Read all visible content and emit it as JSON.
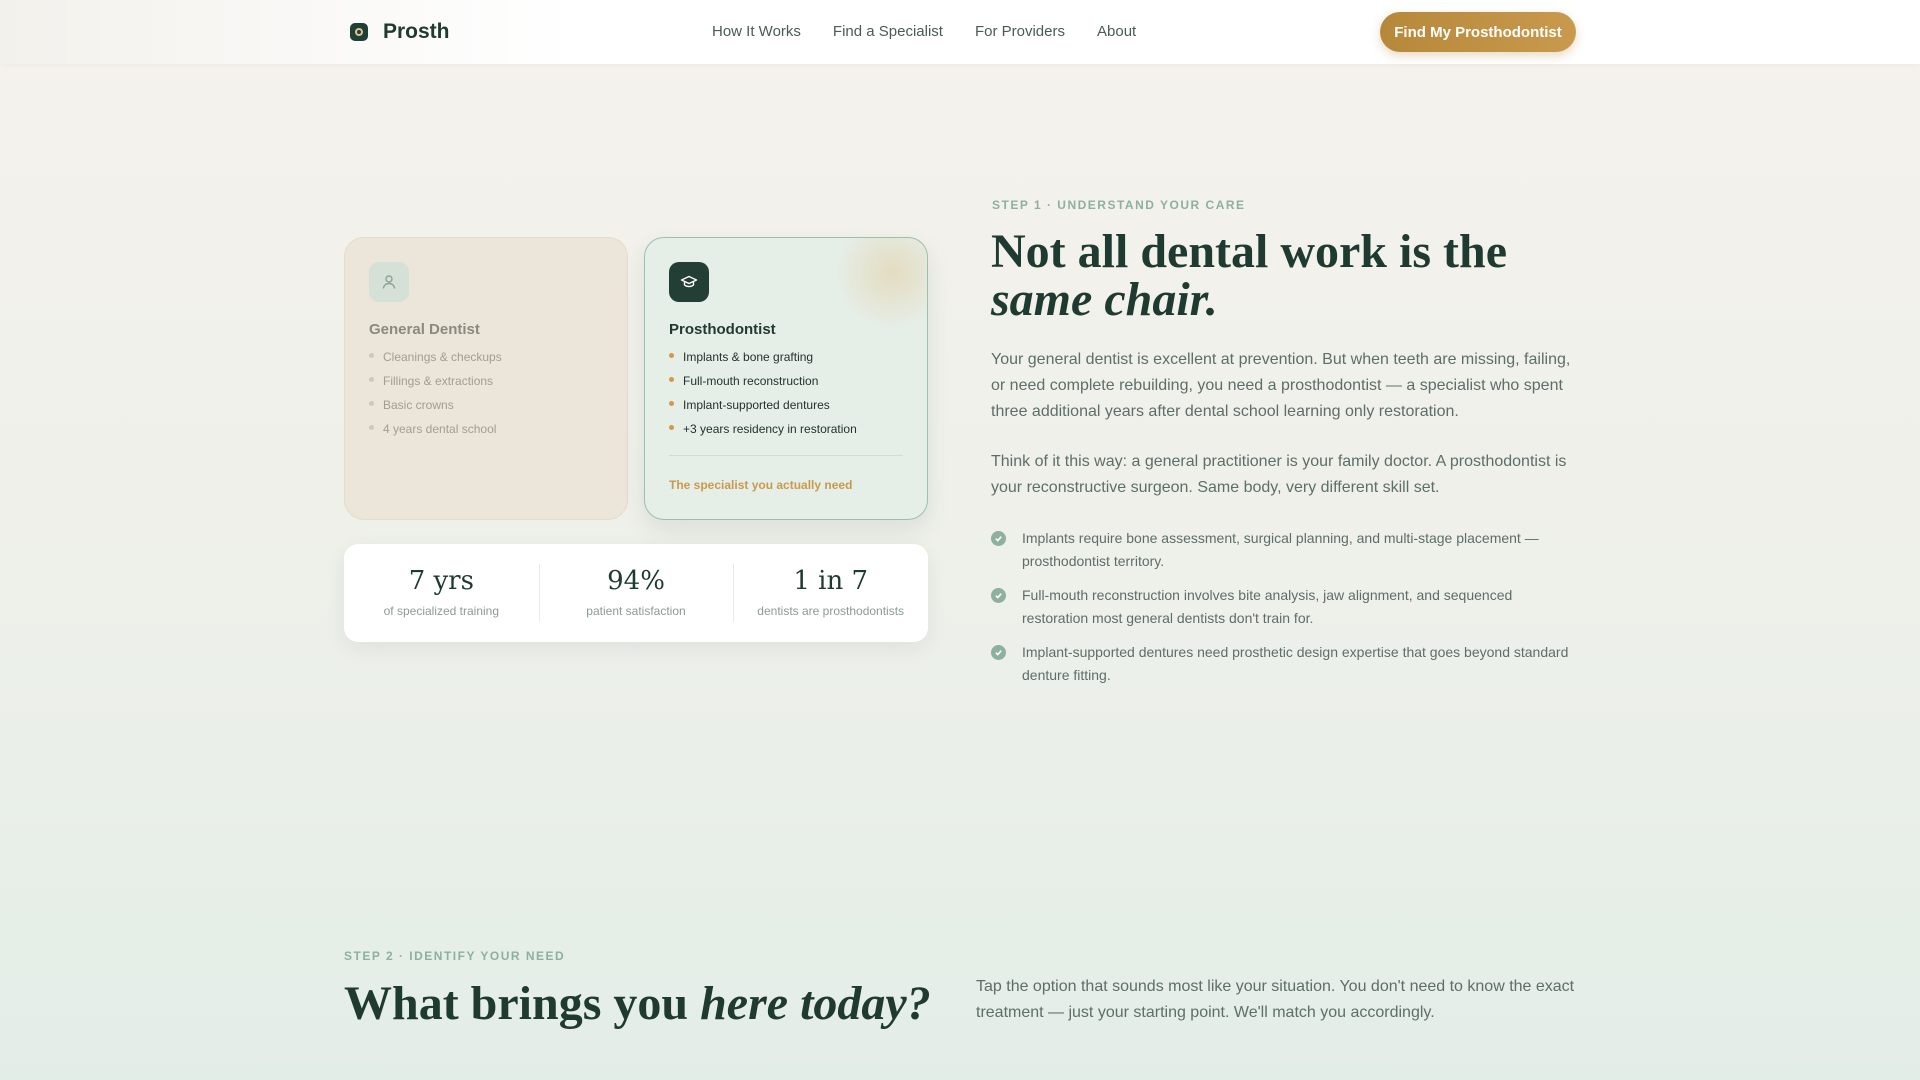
{
  "nav": {
    "brand": "Prosth",
    "links": [
      "How It Works",
      "Find a Specialist",
      "For Providers",
      "About"
    ],
    "cta": "Find My Prosthodontist"
  },
  "comparison": {
    "general": {
      "icon": "person-icon",
      "title": "General Dentist",
      "items": [
        "Cleanings & checkups",
        "Fillings & extractions",
        "Basic crowns",
        "4 years dental school"
      ]
    },
    "prosth": {
      "icon": "graduation-cap-icon",
      "title": "Prosthodontist",
      "items": [
        "Implants & bone grafting",
        "Full-mouth reconstruction",
        "Implant-supported dentures",
        "+3 years residency in restoration"
      ],
      "note": "The specialist you actually need"
    }
  },
  "stats": [
    {
      "value": "7 yrs",
      "label": "of specialized training"
    },
    {
      "value": "94%",
      "label": "patient satisfaction"
    },
    {
      "value": "1 in 7",
      "label": "dentists are prosthodontists"
    }
  ],
  "step1": {
    "eyebrow": "STEP 1 · UNDERSTAND YOUR CARE",
    "headline_plain": "Not all dental work is the",
    "headline_italic": "same chair.",
    "para1": "Your general dentist is excellent at prevention. But when teeth are missing, failing, or need complete rebuilding, you need a prosthodontist — a specialist who spent three additional years after dental school learning only restoration.",
    "para2": "Think of it this way: a general practitioner is your family doctor. A prosthodontist is your reconstructive surgeon. Same body, very different skill set.",
    "checks": [
      "Implants require bone assessment, surgical planning, and multi-stage placement — prosthodontist territory.",
      "Full-mouth reconstruction involves bite analysis, jaw alignment, and sequenced restoration most general dentists don't train for.",
      "Implant-supported dentures need prosthetic design expertise that goes beyond standard denture fitting."
    ]
  },
  "step2": {
    "eyebrow": "STEP 2 · IDENTIFY YOUR NEED",
    "headline_plain": "What brings you",
    "headline_italic": "here today?",
    "para": "Tap the option that sounds most like your situation. You don't need to know the exact treatment — just your starting point. We'll match you accordingly."
  },
  "colors": {
    "accent": "#c99a4d",
    "brand_dark": "#233f35",
    "eyebrow": "#8db09f"
  }
}
